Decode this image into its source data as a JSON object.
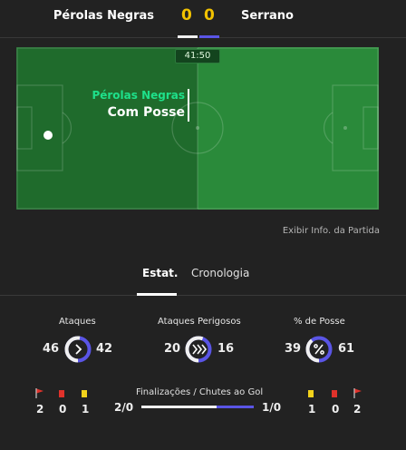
{
  "match": {
    "home_team": "Pérolas Negras",
    "away_team": "Serrano",
    "home_score": "0",
    "away_score": "0",
    "clock": "41:50"
  },
  "pitch": {
    "possession_team": "Pérolas Negras",
    "possession_label": "Com Posse",
    "pitch_color_left": "#1f6b2c",
    "pitch_color_right": "#2a8a3a"
  },
  "info_link": "Exibir Info. da Partida",
  "tabs": [
    {
      "label": "Estat.",
      "active": true
    },
    {
      "label": "Cronologia",
      "active": false
    }
  ],
  "stats": [
    {
      "title": "Ataques",
      "home": "46",
      "away": "42",
      "icon": "chevron-right-icon",
      "home_share": 0.523
    },
    {
      "title": "Ataques Perigosos",
      "home": "20",
      "away": "16",
      "icon": "double-chevron-icon",
      "home_share": 0.556
    },
    {
      "title": "% de Posse",
      "home": "39",
      "away": "61",
      "icon": "percent-icon",
      "home_share": 0.39
    }
  ],
  "events": {
    "home": {
      "corners": "2",
      "red_cards": "0",
      "yellow_cards": "1"
    },
    "away": {
      "yellow_cards": "1",
      "red_cards": "0",
      "corners": "2"
    }
  },
  "shots": {
    "title": "Finalizações / Chutes ao Gol",
    "home": "2/0",
    "away": "1/0",
    "home_share": 0.667
  },
  "colors": {
    "accent_away": "#5a55e6",
    "score": "#f2c200",
    "possession_team": "#1ee08a",
    "yellow_card": "#f2d21b",
    "red_card": "#e0322b"
  }
}
